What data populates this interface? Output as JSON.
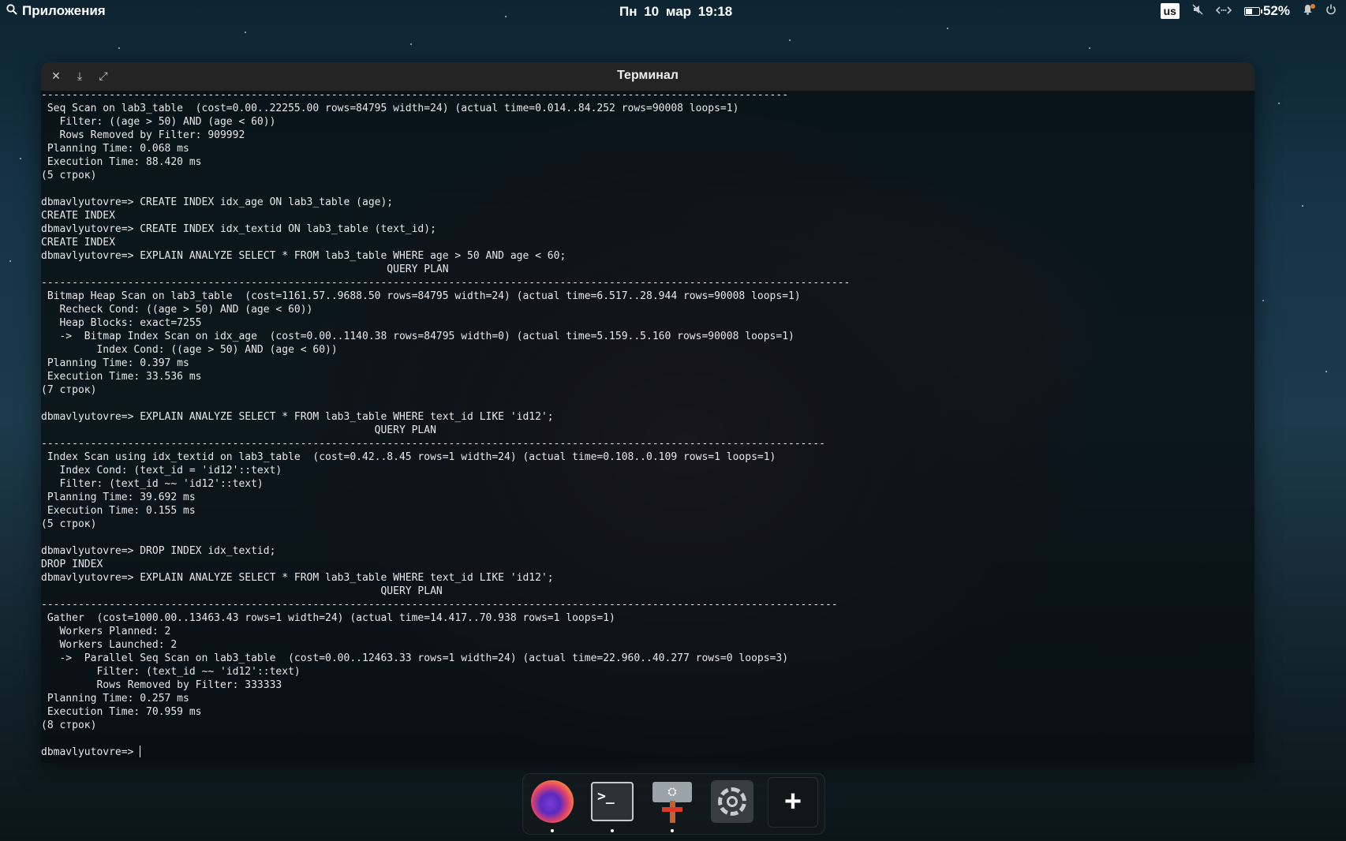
{
  "topbar": {
    "apps_label": "Приложения",
    "date": "Пн 10 мар",
    "time": "19:18",
    "keyboard_layout": "us",
    "battery_percent": "52%"
  },
  "terminal": {
    "title": "Терминал",
    "lines": [
      "-------------------------------------------------------------------------------------------------------------------------",
      " Seq Scan on lab3_table  (cost=0.00..22255.00 rows=84795 width=24) (actual time=0.014..84.252 rows=90008 loops=1)",
      "   Filter: ((age > 50) AND (age < 60))",
      "   Rows Removed by Filter: 909992",
      " Planning Time: 0.068 ms",
      " Execution Time: 88.420 ms",
      "(5 строк)",
      "",
      "dbmavlyutovre=> CREATE INDEX idx_age ON lab3_table (age);",
      "CREATE INDEX",
      "dbmavlyutovre=> CREATE INDEX idx_textid ON lab3_table (text_id);",
      "CREATE INDEX",
      "dbmavlyutovre=> EXPLAIN ANALYZE SELECT * FROM lab3_table WHERE age > 50 AND age < 60;",
      "                                                        QUERY PLAN",
      "-----------------------------------------------------------------------------------------------------------------------------------",
      " Bitmap Heap Scan on lab3_table  (cost=1161.57..9688.50 rows=84795 width=24) (actual time=6.517..28.944 rows=90008 loops=1)",
      "   Recheck Cond: ((age > 50) AND (age < 60))",
      "   Heap Blocks: exact=7255",
      "   ->  Bitmap Index Scan on idx_age  (cost=0.00..1140.38 rows=84795 width=0) (actual time=5.159..5.160 rows=90008 loops=1)",
      "         Index Cond: ((age > 50) AND (age < 60))",
      " Planning Time: 0.397 ms",
      " Execution Time: 33.536 ms",
      "(7 строк)",
      "",
      "dbmavlyutovre=> EXPLAIN ANALYZE SELECT * FROM lab3_table WHERE text_id LIKE 'id12';",
      "                                                      QUERY PLAN",
      "-------------------------------------------------------------------------------------------------------------------------------",
      " Index Scan using idx_textid on lab3_table  (cost=0.42..8.45 rows=1 width=24) (actual time=0.108..0.109 rows=1 loops=1)",
      "   Index Cond: (text_id = 'id12'::text)",
      "   Filter: (text_id ~~ 'id12'::text)",
      " Planning Time: 39.692 ms",
      " Execution Time: 0.155 ms",
      "(5 строк)",
      "",
      "dbmavlyutovre=> DROP INDEX idx_textid;",
      "DROP INDEX",
      "dbmavlyutovre=> EXPLAIN ANALYZE SELECT * FROM lab3_table WHERE text_id LIKE 'id12';",
      "                                                       QUERY PLAN",
      "---------------------------------------------------------------------------------------------------------------------------------",
      " Gather  (cost=1000.00..13463.43 rows=1 width=24) (actual time=14.417..70.938 rows=1 loops=1)",
      "   Workers Planned: 2",
      "   Workers Launched: 2",
      "   ->  Parallel Seq Scan on lab3_table  (cost=0.00..12463.33 rows=1 width=24) (actual time=22.960..40.277 rows=0 loops=3)",
      "         Filter: (text_id ~~ 'id12'::text)",
      "         Rows Removed by Filter: 333333",
      " Planning Time: 0.257 ms",
      " Execution Time: 70.959 ms",
      "(8 строк)",
      ""
    ],
    "prompt": "dbmavlyutovre=> "
  },
  "dock": {
    "items": [
      {
        "icon": "firefox-icon",
        "running": true
      },
      {
        "icon": "terminal-icon",
        "running": true,
        "glyph": ">_"
      },
      {
        "icon": "package-installer-icon",
        "running": true,
        "glyph": "⛭"
      },
      {
        "icon": "settings-gear-icon",
        "running": false
      },
      {
        "icon": "add-icon",
        "glyph": "+"
      }
    ]
  }
}
